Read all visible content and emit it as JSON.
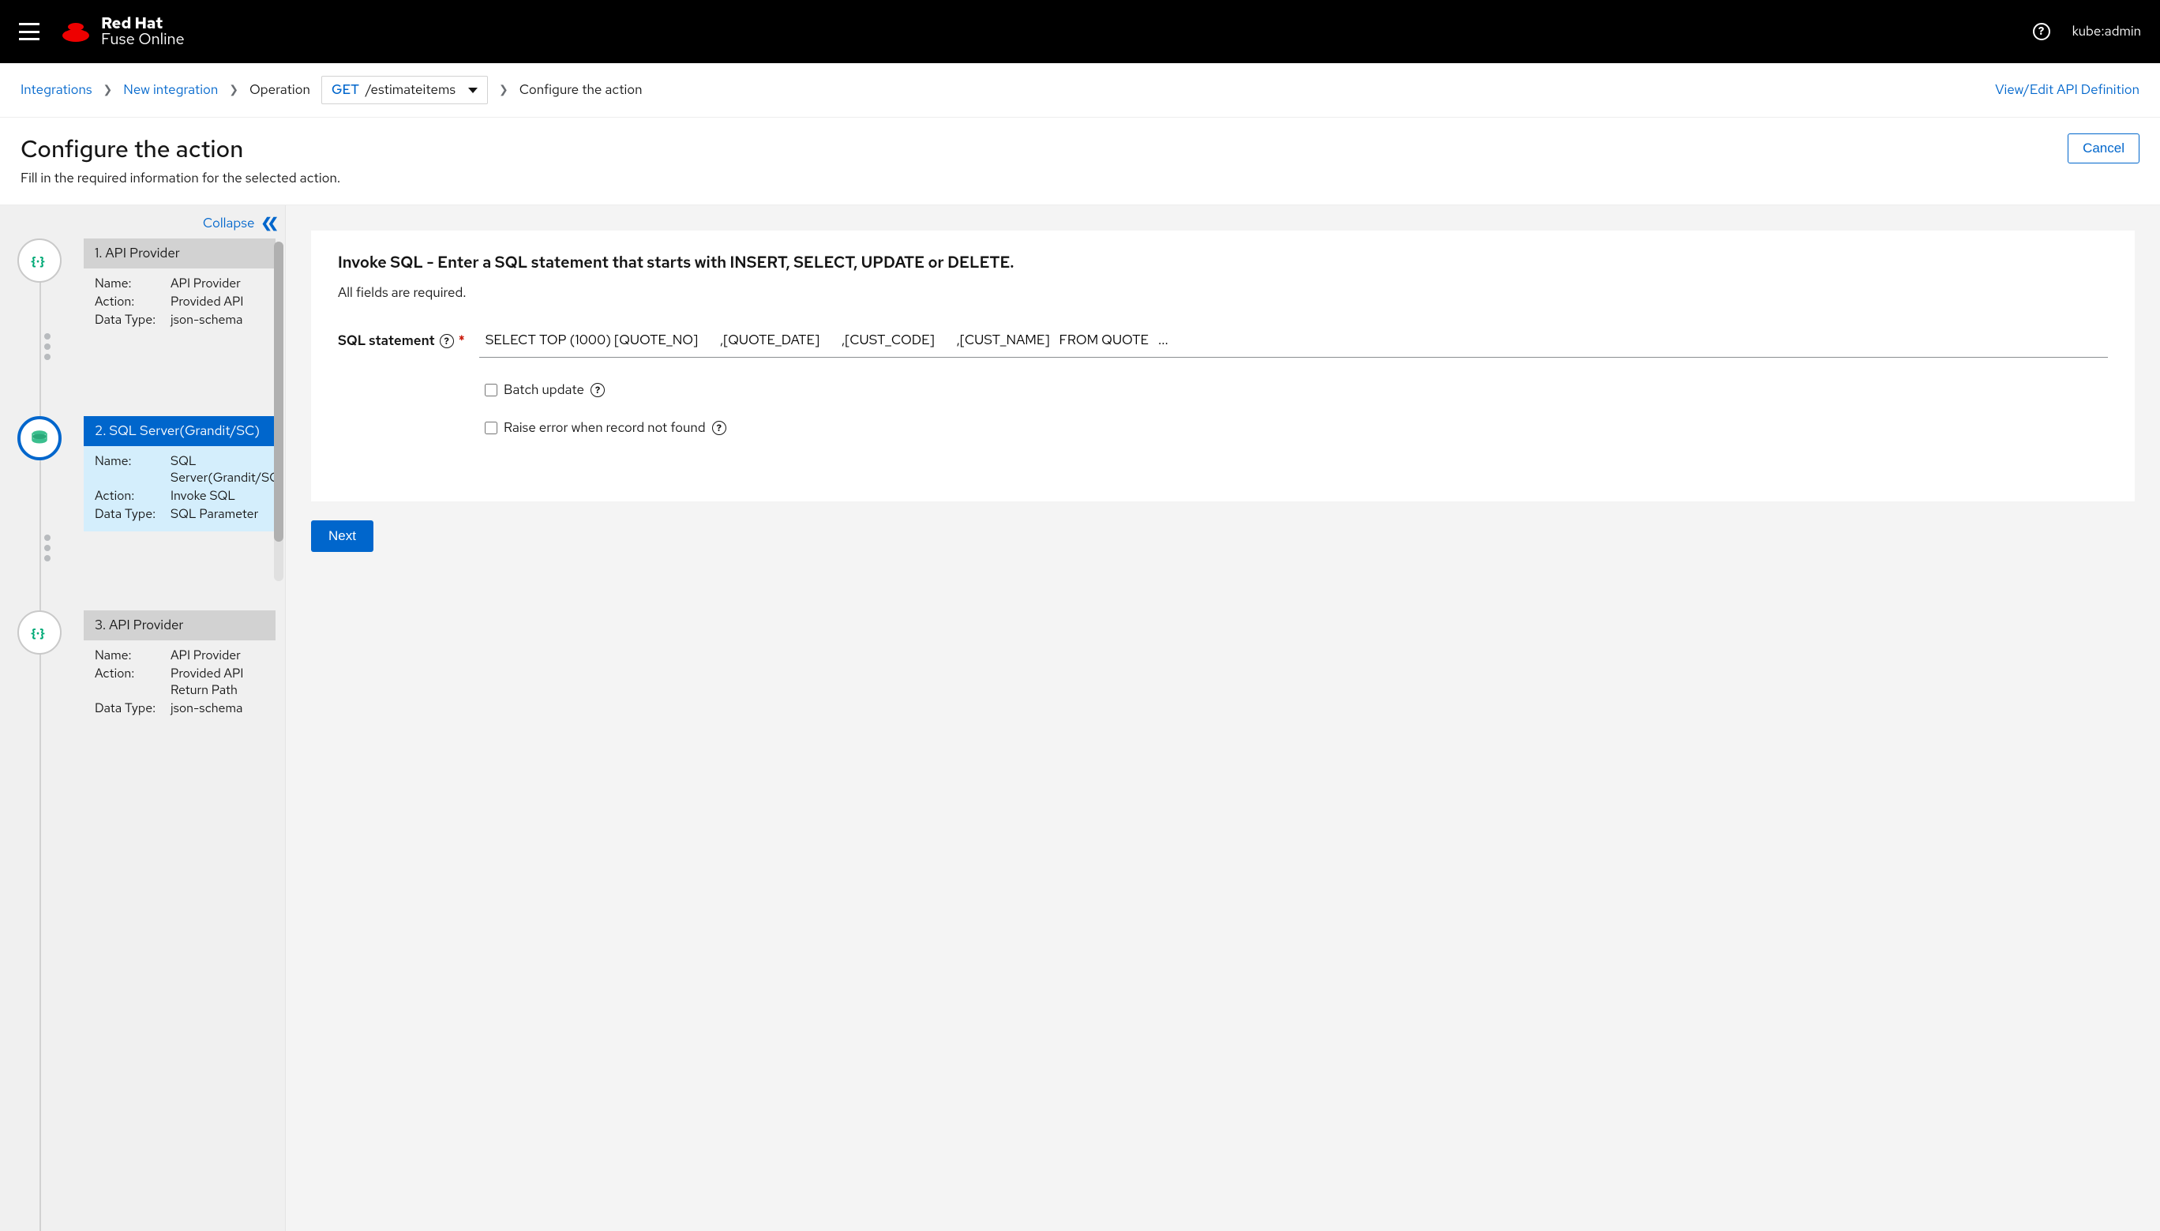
{
  "masthead": {
    "brand_top": "Red Hat",
    "brand_sub": "Fuse Online",
    "username": "kube:admin"
  },
  "breadcrumb": {
    "integrations": "Integrations",
    "new_integration": "New integration",
    "operation_label": "Operation",
    "method": "GET",
    "path": "/estimateitems",
    "current": "Configure the action",
    "api_link": "View/Edit API Definition"
  },
  "page": {
    "title": "Configure the action",
    "desc": "Fill in the required information for the selected action.",
    "cancel": "Cancel"
  },
  "left": {
    "collapse": "Collapse",
    "steps": [
      {
        "title": "1. API Provider",
        "name_label": "Name:",
        "name": "API Provider",
        "action_label": "Action:",
        "action": "Provided API",
        "data_label": "Data Type:",
        "data": "json-schema"
      },
      {
        "title": "2. SQL Server(Grandit/SC)",
        "name_label": "Name:",
        "name": "SQL Server(Grandit/SC)",
        "action_label": "Action:",
        "action": "Invoke SQL",
        "data_label": "Data Type:",
        "data": "SQL Parameter"
      },
      {
        "title": "3. API Provider",
        "name_label": "Name:",
        "name": "API Provider",
        "action_label": "Action:",
        "action": "Provided API Return Path",
        "data_label": "Data Type:",
        "data": "json-schema"
      }
    ]
  },
  "form": {
    "heading": "Invoke SQL - Enter a SQL statement that starts with INSERT, SELECT, UPDATE or DELETE.",
    "required_note": "All fields are required.",
    "sql_label": "SQL statement",
    "sql_value": "SELECT TOP (1000) [QUOTE_NO]       ,[QUOTE_DATE]       ,[CUST_CODE]       ,[CUST_NAME]   FROM QUOTE   ...",
    "batch_label": "Batch update",
    "raise_label": "Raise error when record not found",
    "next": "Next"
  }
}
